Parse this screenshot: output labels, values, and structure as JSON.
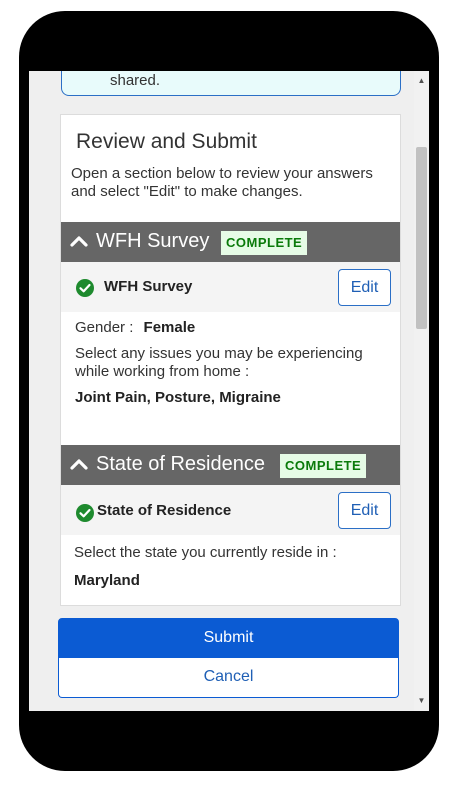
{
  "info_card": {
    "text": "shared."
  },
  "review": {
    "title": "Review and Submit",
    "description": "Open a section below to review your answers and select \"Edit\" to make changes."
  },
  "sections": [
    {
      "title": "WFH Survey",
      "badge": "COMPLETE",
      "subtitle": "WFH Survey",
      "edit_label": "Edit",
      "answers": {
        "gender_label": "Gender :",
        "gender_value": "Female",
        "issues_question": "Select any issues you may be experiencing while working from home :",
        "issues_value": "Joint Pain, Posture, Migraine"
      }
    },
    {
      "title": "State of Residence",
      "badge": "COMPLETE",
      "subtitle": "State of Residence",
      "edit_label": "Edit",
      "answers": {
        "state_question": "Select the state you currently reside in :",
        "state_value": "Maryland"
      }
    }
  ],
  "actions": {
    "submit_label": "Submit",
    "cancel_label": "Cancel"
  },
  "colors": {
    "primary": "#0b5bd3",
    "section_header": "#666666",
    "complete_badge_bg": "#e6fbe6",
    "complete_badge_text": "#0a7a0a",
    "check_green": "#1e8a2e"
  },
  "icons": {
    "section_toggle": "chevron-up-icon",
    "status": "check-circle-icon",
    "scroll_up": "scroll-up-arrow-icon",
    "scroll_down": "scroll-down-arrow-icon"
  }
}
